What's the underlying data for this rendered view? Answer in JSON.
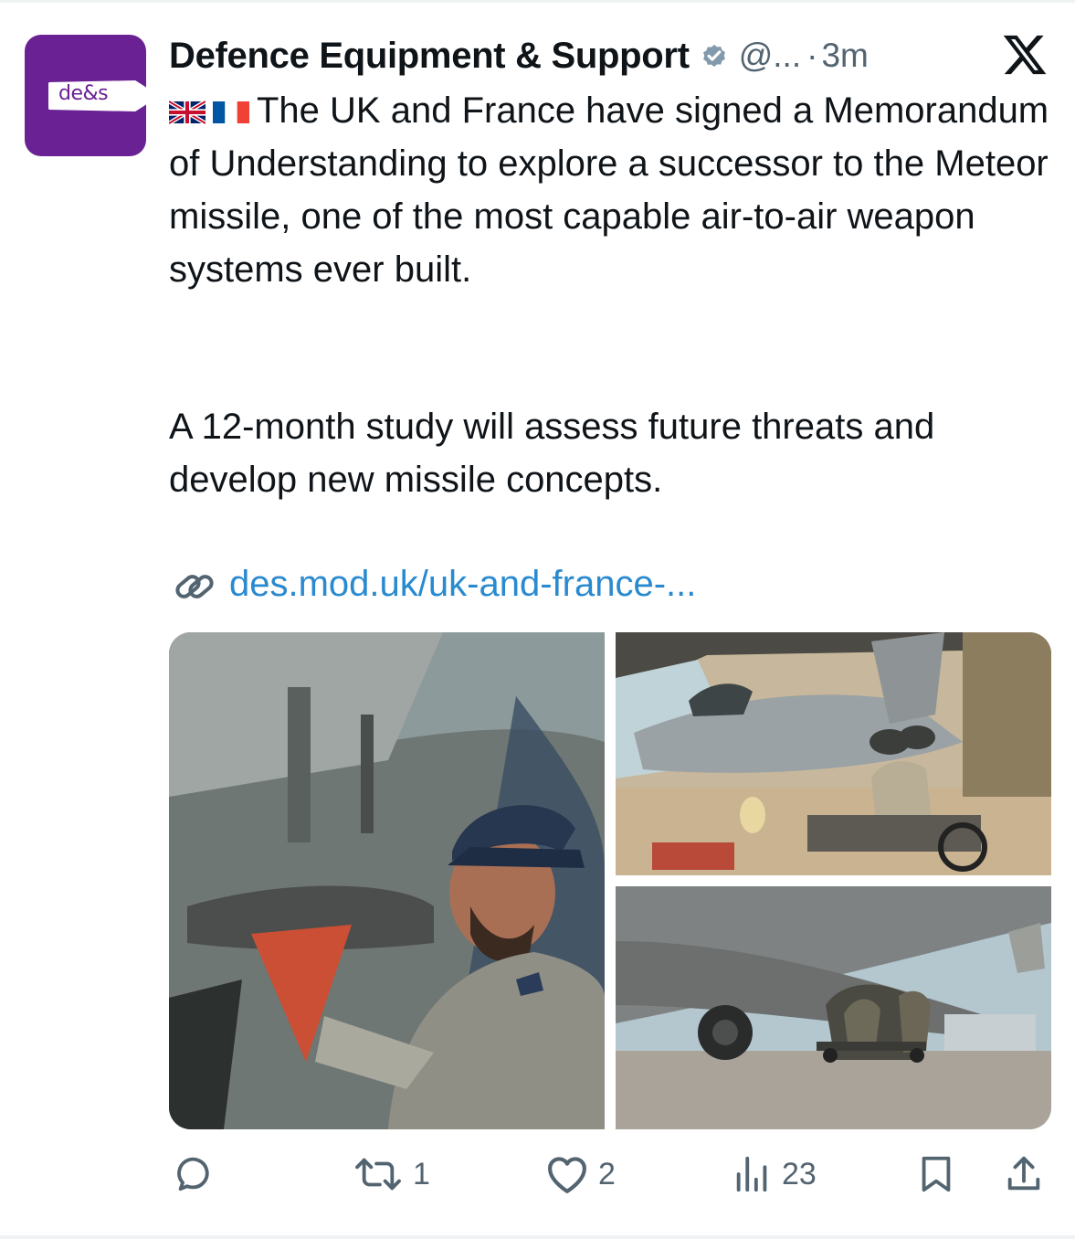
{
  "tweet": {
    "avatar_logo_text": "de&s",
    "display_name": "Defence Equipment & Support",
    "handle": "@...",
    "separator": "·",
    "time": "3m",
    "text_line1": "The UK and France have signed a Memorandum of Understanding to explore a successor to the Meteor missile, one of the most capable air-to-air weapon systems ever built.",
    "text_para2": "A 12-month study will assess future threats and develop new missile concepts.",
    "link": "des.mod.uk/uk-and-france-..."
  },
  "flags": [
    "uk-flag",
    "france-flag"
  ],
  "actions": {
    "reply_count": "",
    "retweet_count": "1",
    "like_count": "2",
    "views_count": "23"
  },
  "icons": [
    "verified-icon",
    "x-logo-icon",
    "link-icon",
    "reply-icon",
    "retweet-icon",
    "like-icon",
    "views-icon",
    "bookmark-icon",
    "share-icon"
  ],
  "colors": {
    "avatar_bg": "#6a2193",
    "link": "#2a8ad0",
    "muted": "#536471",
    "text": "#0f1419"
  }
}
